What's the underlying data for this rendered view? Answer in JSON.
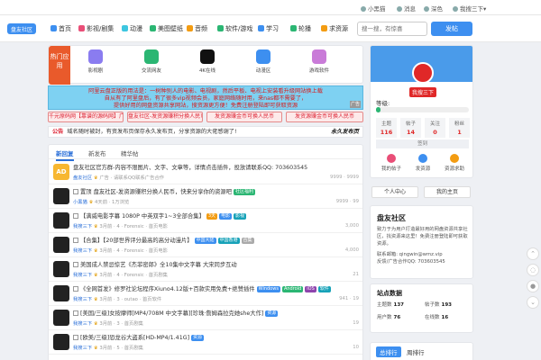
{
  "topbar": {
    "user": "小黑猫",
    "messages": "消息",
    "theme": "深色",
    "search_menu": "我搜三下▾"
  },
  "nav": {
    "logo_text": "盘友社区",
    "items": [
      {
        "label": "首页",
        "color": "#3d8ff0"
      },
      {
        "label": "影视/剧集",
        "color": "#e94e77"
      },
      {
        "label": "动漫",
        "color": "#3dc6e0"
      },
      {
        "label": "美图壁纸",
        "color": "#2bb673"
      },
      {
        "label": "音频",
        "color": "#f39c12"
      },
      {
        "label": "软件/游戏",
        "color": "#2bb673"
      },
      {
        "label": "学习",
        "color": "#3d8ff0"
      },
      {
        "label": "轮播",
        "color": "#2bb673"
      },
      {
        "label": "求资源",
        "color": "#f39c12"
      }
    ],
    "search_placeholder": "搜一搜，有惊喜",
    "search_button": "发帖"
  },
  "apps": {
    "hot_label": "热门应用",
    "items": [
      {
        "label": "影视剧",
        "color": "#8a7cf0"
      },
      {
        "label": "交流网友",
        "color": "#2bb673"
      },
      {
        "label": "4K在线",
        "color": "#111111"
      },
      {
        "label": "动漫区",
        "color": "#3d8ff0"
      },
      {
        "label": "游戏软件",
        "color": "#c97bd8"
      }
    ]
  },
  "marquee": {
    "line1": "阿里云盘正版的用法是：一树种别人的电影、电视剧，然后平板、电视上安装看升级网站换上载",
    "line2": "自从有了阿里盘后，有了很多vip视频会员，家庭网络随时用，来nas都不需要了，",
    "line3": "提供好用的网盘资源共享网站，搜资源更方便！免费注册登陆即可获取资源",
    "ad": "广告"
  },
  "pills": [
    "千元原码网【靠谱的源码网】广告",
    "盘友社区-发资源赚积分换人民币",
    "发资源赚金币可换人民币",
    "发资源赚金币可换人民币"
  ],
  "notice": {
    "tag": "公告",
    "text": "域名随时被封，有资发布页保存永久发布页，分享资源的大佬感谢了!",
    "right": "永久发布页"
  },
  "tabs": [
    "新回复",
    "新发布",
    "精华帖"
  ],
  "posts": [
    {
      "avatar": "AD",
      "title": "盘友社区官方群-内容不限图片、文字、文章等，详情点击插件，投放请联系QQ: 703603545",
      "chk": false,
      "meta_user": "盘友社区",
      "meta_extra": "广告 · 请联系QQ联系广告合作",
      "stat": "9999 · 9999",
      "badges": []
    },
    {
      "avatar": "",
      "title": "置顶 盘友社区-发资源赚积分换人民币，快来分享你的资源吧",
      "chk": true,
      "meta_user": "小黑猫",
      "meta_extra": "4天前 · 1万浏览",
      "stat": "9999 · 99",
      "badges": [
        {
          "text": "社区福利",
          "cls": "b-green"
        }
      ]
    },
    {
      "avatar": "",
      "title": "【满威电影字幕 1080P 中英双字1~3全部合集】",
      "chk": true,
      "meta_user": "我搜三下",
      "meta_extra": "3月前 · 4 · Forensic · 首页电影",
      "stat": "3,000",
      "badges": [
        {
          "text": "3天",
          "cls": "b-orange"
        },
        {
          "text": "电影",
          "cls": "b-blue"
        },
        {
          "text": "影视",
          "cls": "b-teal"
        }
      ]
    },
    {
      "avatar": "",
      "title": "【合集】【20部世界评分最高的高分动漫片】",
      "chk": true,
      "meta_user": "我搜三下",
      "meta_extra": "3月前 · 4 · Forensic · 首页电影",
      "stat": "4,000",
      "badges": [
        {
          "text": "中国大陆",
          "cls": "b-blue"
        },
        {
          "text": "中国香港",
          "cls": "b-teal"
        },
        {
          "text": "合集",
          "cls": "b-gray"
        }
      ]
    },
    {
      "avatar": "",
      "title": "美国成人禁忌惊艺《杰菲密郎》全10集中文字幕 大宋同步互动",
      "chk": true,
      "meta_user": "我搜三下",
      "meta_extra": "3月前 · 4 · Forensic · 首页剧集",
      "stat": "21",
      "badges": []
    },
    {
      "avatar": "",
      "title": "《全网首发》修罗社论坛程序Xiuno4.12版+百款实用免费+绝赞插件",
      "chk": true,
      "meta_user": "我搜三下",
      "meta_extra": "3月前 · 3 · outao · 首页软件",
      "stat": "941 · 19",
      "badges": [
        {
          "text": "Windows",
          "cls": "b-blue"
        },
        {
          "text": "Android",
          "cls": "b-green"
        },
        {
          "text": "iOS",
          "cls": "b-purple"
        },
        {
          "text": "软件",
          "cls": "b-teal"
        }
      ]
    },
    {
      "avatar": "",
      "title": "[美国/三级]女按摩师[MP4/708M 中文字幕][珍珠·詹姆森拉克她she大作]",
      "chk": true,
      "meta_user": "我搜三下",
      "meta_extra": "3月前 · 3 · 首页剧集",
      "stat": "19",
      "badges": [
        {
          "text": "资源",
          "cls": "b-blue"
        }
      ]
    },
    {
      "avatar": "",
      "title": "[欧美/三级]恐龙谷大盗系[HD-MP4/1.41G]",
      "chk": true,
      "meta_user": "我搜三下",
      "meta_extra": "3月前 · 5 · 首页剧集",
      "stat": "10",
      "badges": [
        {
          "text": "资源",
          "cls": "b-blue"
        }
      ]
    }
  ],
  "profile": {
    "username": "我搜三下",
    "level_label": "等级:",
    "level_value": 0.05,
    "grid": [
      {
        "label": "主题",
        "value": "116"
      },
      {
        "label": "帖子",
        "value": "14"
      },
      {
        "label": "关注",
        "value": "0"
      },
      {
        "label": "粉丝",
        "value": "1"
      }
    ],
    "sign_label": "签到",
    "quick": [
      "我的帖子",
      "发资源",
      "资源求助"
    ]
  },
  "user_buttons": [
    "个人中心",
    "我的主页"
  ],
  "about": {
    "title": "盘友社区",
    "desc": "致力于为用户打造最好用的网盘资源共享社区，找资源来这里！免费注册登陆即可获取资源。",
    "contact": "联系邮箱: qingwin@wmz.vip",
    "feedback": "反馈/广告合作QQ: 703603545"
  },
  "stats": {
    "title": "站点数据",
    "items": [
      {
        "label": "主题数",
        "value": "137"
      },
      {
        "label": "帖子数",
        "value": "193"
      },
      {
        "label": "用户数",
        "value": "76"
      },
      {
        "label": "在线数",
        "value": "16"
      }
    ]
  },
  "rank": [
    "总排行",
    "周排行"
  ]
}
